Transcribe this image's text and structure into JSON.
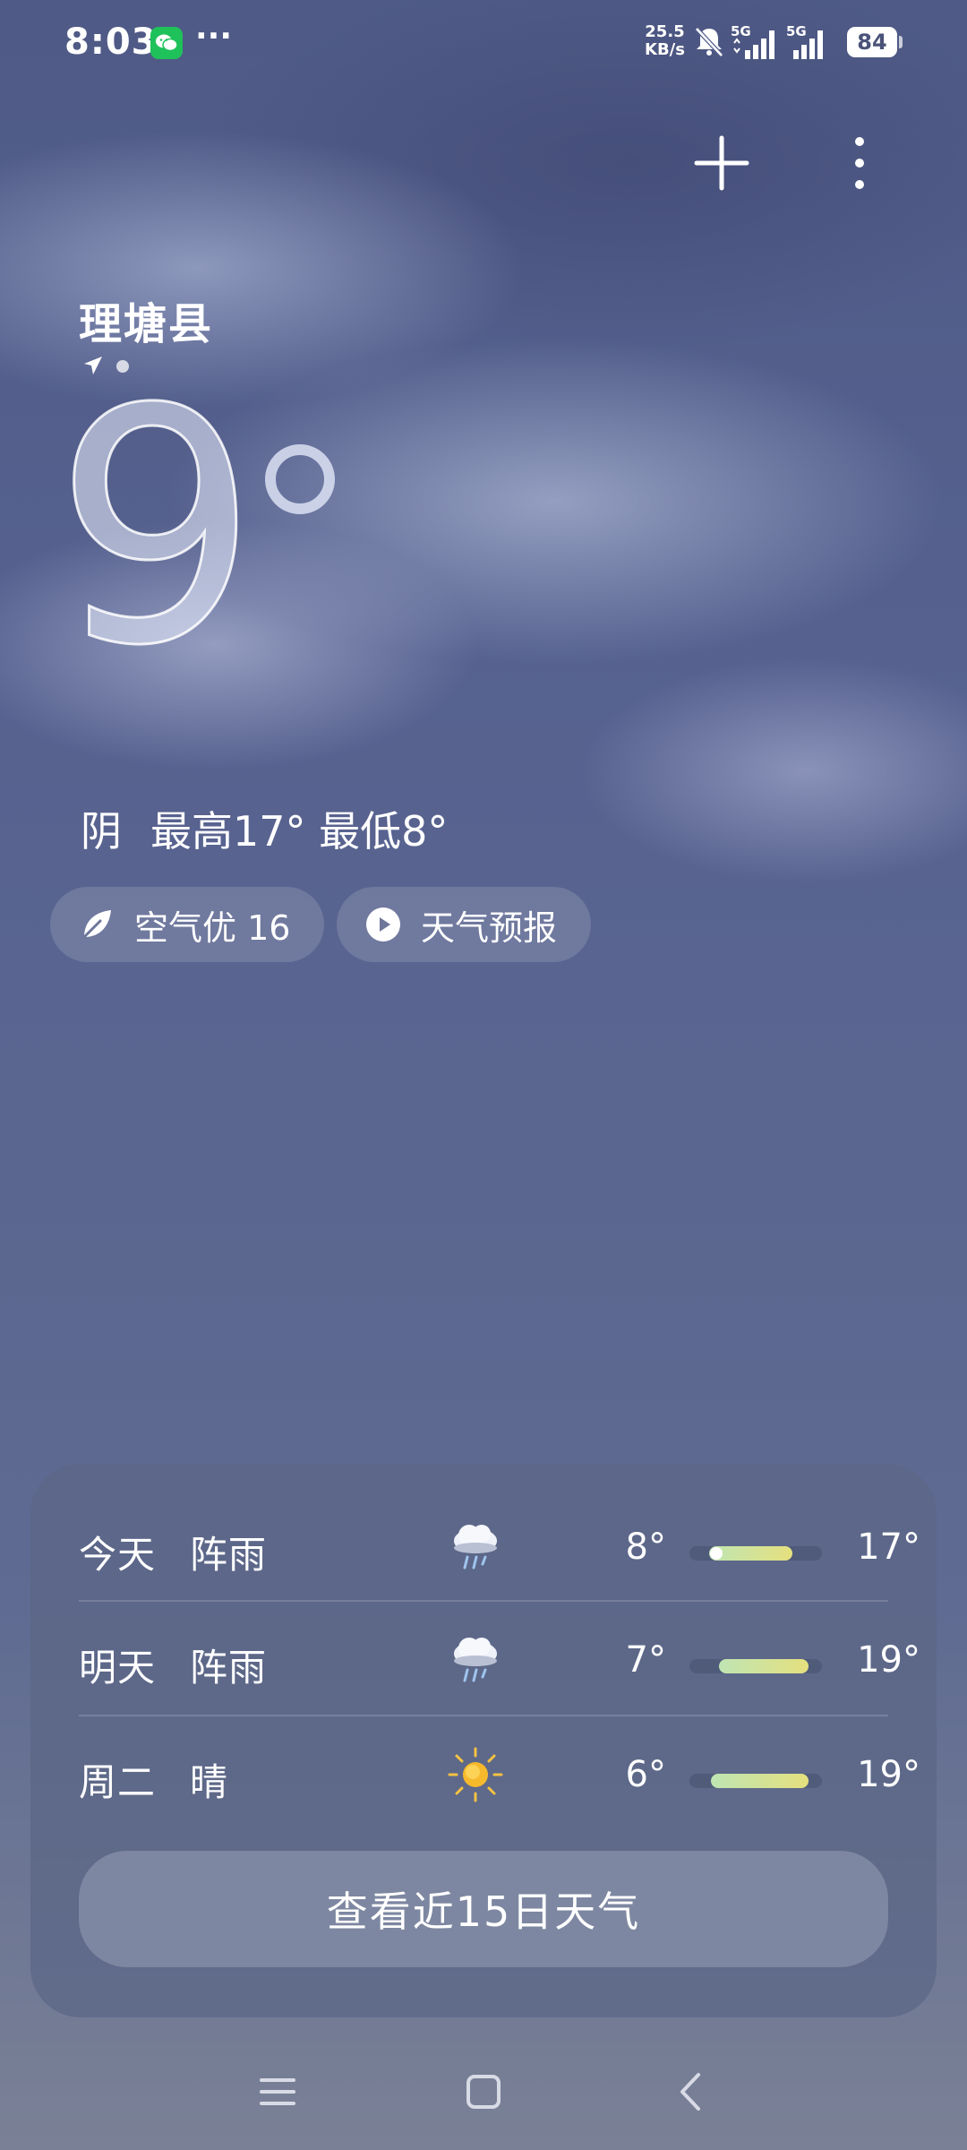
{
  "status_bar": {
    "time": "8:03",
    "more": "···",
    "net_speed_value": "25.5",
    "net_speed_unit": "KB/s",
    "signal1_label": "5G",
    "signal2_label": "5G",
    "battery": "84"
  },
  "location": {
    "city": "理塘县"
  },
  "current": {
    "temperature": "9",
    "condition": "阴",
    "high_low": "最高17° 最低8°"
  },
  "chips": {
    "air_quality": "空气优 16",
    "forecast": "天气预报"
  },
  "forecast": {
    "days": [
      {
        "day": "今天",
        "condition": "阵雨",
        "icon": "rain-cloud-icon",
        "low": "8°",
        "high": "17°",
        "range_start": 0.15,
        "range_end": 0.78,
        "current_marker": 0.2
      },
      {
        "day": "明天",
        "condition": "阵雨",
        "icon": "rain-cloud-icon",
        "low": "7°",
        "high": "19°",
        "range_start": 0.22,
        "range_end": 0.9
      },
      {
        "day": "周二",
        "condition": "晴",
        "icon": "sun-icon",
        "low": "6°",
        "high": "19°",
        "range_start": 0.16,
        "range_end": 0.9
      }
    ],
    "more_button": "查看近15日天气"
  },
  "colors": {
    "range_bar_start": "#bfe5b3",
    "range_bar_end": "#e5e07e",
    "wechat": "#1fc15a"
  }
}
